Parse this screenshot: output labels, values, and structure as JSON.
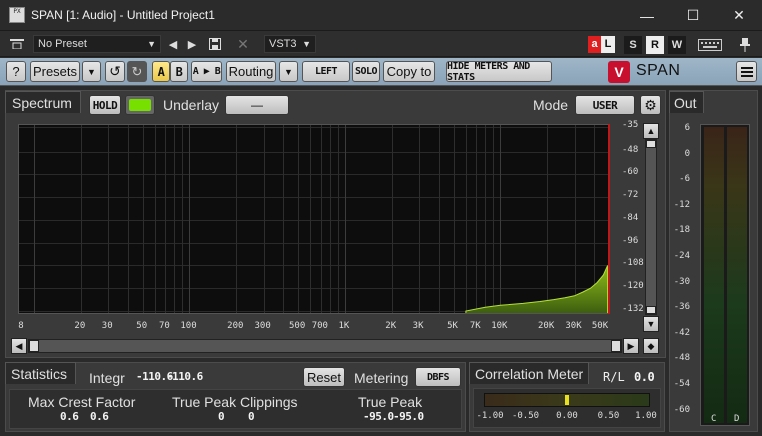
{
  "window": {
    "title": "SPAN [1: Audio] - Untitled Project1",
    "minimize": "—",
    "maximize": "☐",
    "close": "✕",
    "icon_text": "PX"
  },
  "host": {
    "preset": "No Preset",
    "format": "VST3",
    "audio_label": "a",
    "audio_label2": "L",
    "s": "S",
    "r": "R",
    "w": "W"
  },
  "toolbar": {
    "help": "?",
    "presets": "Presets",
    "a": "A",
    "b": "B",
    "ab": "A ▶ B",
    "routing": "Routing",
    "left": "LEFT",
    "solo": "SOLO",
    "copy_to": "Copy to",
    "hide": "HIDE METERS AND STATS",
    "logo": "SPAN"
  },
  "spectrum": {
    "title": "Spectrum",
    "hold": "HOLD",
    "underlay_label": "Underlay",
    "underlay_value": "—",
    "mode_label": "Mode",
    "mode_value": "USER",
    "y_ticks": [
      "-35",
      "-48",
      "-60",
      "-72",
      "-84",
      "-96",
      "-108",
      "-120",
      "-132"
    ],
    "x_ticks": [
      {
        "label": "8",
        "f": 8
      },
      {
        "label": "20",
        "f": 20
      },
      {
        "label": "30",
        "f": 30
      },
      {
        "label": "50",
        "f": 50
      },
      {
        "label": "70",
        "f": 70
      },
      {
        "label": "100",
        "f": 100
      },
      {
        "label": "200",
        "f": 200
      },
      {
        "label": "300",
        "f": 300
      },
      {
        "label": "500",
        "f": 500
      },
      {
        "label": "700",
        "f": 700
      },
      {
        "label": "1K",
        "f": 1000
      },
      {
        "label": "2K",
        "f": 2000
      },
      {
        "label": "3K",
        "f": 3000
      },
      {
        "label": "5K",
        "f": 5000
      },
      {
        "label": "7K",
        "f": 7000
      },
      {
        "label": "10K",
        "f": 10000
      },
      {
        "label": "20K",
        "f": 20000
      },
      {
        "label": "30K",
        "f": 30000
      },
      {
        "label": "50K",
        "f": 50000
      }
    ]
  },
  "chart_data": {
    "type": "area",
    "xscale": "log",
    "xlim": [
      8,
      50000
    ],
    "ylim": [
      -132,
      -35
    ],
    "series": [
      {
        "x": [
          6000,
          8000,
          10000,
          14000,
          18000,
          22000,
          26000,
          30000,
          34000,
          38000,
          42000,
          46000,
          49000
        ],
        "y": [
          -132,
          -130,
          -129,
          -128,
          -127,
          -126,
          -125,
          -124,
          -122,
          -120,
          -117,
          -113,
          -108
        ]
      }
    ]
  },
  "stats": {
    "title": "Statistics",
    "integr_label": "Integr",
    "integr_l": "-110.6",
    "integr_r": "-110.6",
    "reset": "Reset",
    "metering_label": "Metering",
    "metering_value": "DBFS",
    "crest_label": "Max Crest Factor",
    "crest_l": "0.6",
    "crest_r": "0.6",
    "clip_label": "True Peak Clippings",
    "clip_l": "0",
    "clip_r": "0",
    "tp_label": "True Peak",
    "tp_l": "-95.0",
    "tp_r": "-95.0"
  },
  "correlation": {
    "title": "Correlation Meter",
    "mode": "R/L",
    "value": "0.0",
    "ticks": [
      "-1.00",
      "-0.50",
      "0.00",
      "0.50",
      "1.00"
    ],
    "level": 0.0
  },
  "out": {
    "title": "Out",
    "ticks": [
      "6",
      "0",
      "-6",
      "-12",
      "-18",
      "-24",
      "-30",
      "-36",
      "-42",
      "-48",
      "-54",
      "-60"
    ],
    "ch_c": "C",
    "ch_d": "D"
  }
}
